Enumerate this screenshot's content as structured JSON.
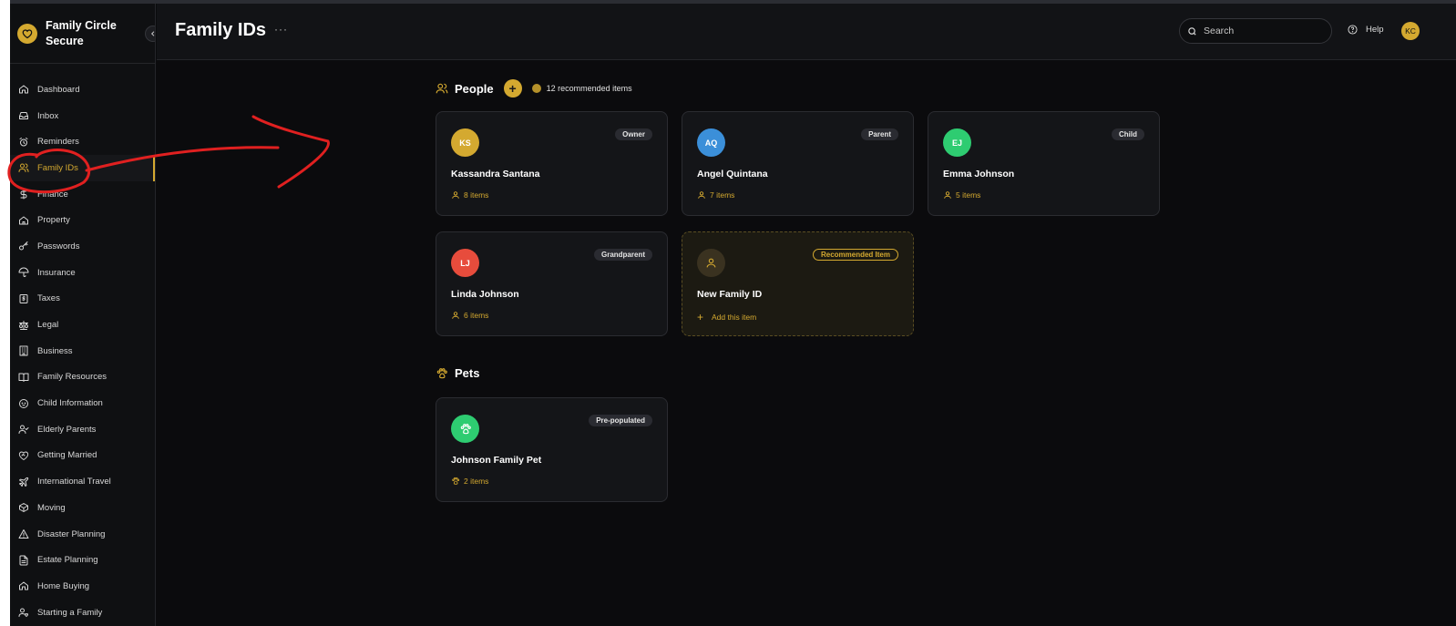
{
  "app": {
    "brand_name": "Family Circle Secure",
    "accent_color": "#d4a930"
  },
  "sidebar": {
    "items": [
      {
        "label": "Dashboard",
        "icon": "home-icon"
      },
      {
        "label": "Inbox",
        "icon": "inbox-icon"
      },
      {
        "label": "Reminders",
        "icon": "alarm-clock-icon"
      },
      {
        "label": "Family IDs",
        "icon": "users-icon",
        "active": true
      },
      {
        "label": "Finance",
        "icon": "dollar-icon"
      },
      {
        "label": "Property",
        "icon": "house-icon"
      },
      {
        "label": "Passwords",
        "icon": "key-icon"
      },
      {
        "label": "Insurance",
        "icon": "umbrella-icon"
      },
      {
        "label": "Taxes",
        "icon": "receipt-dollar-icon"
      },
      {
        "label": "Legal",
        "icon": "scale-icon"
      },
      {
        "label": "Business",
        "icon": "building-icon"
      },
      {
        "label": "Family Resources",
        "icon": "book-icon"
      },
      {
        "label": "Child Information",
        "icon": "baby-icon"
      },
      {
        "label": "Elderly Parents",
        "icon": "user-check-icon"
      },
      {
        "label": "Getting Married",
        "icon": "heart-handshake-icon"
      },
      {
        "label": "International Travel",
        "icon": "plane-icon"
      },
      {
        "label": "Moving",
        "icon": "box-icon"
      },
      {
        "label": "Disaster Planning",
        "icon": "warning-icon"
      },
      {
        "label": "Estate Planning",
        "icon": "document-icon"
      },
      {
        "label": "Home Buying",
        "icon": "home-icon"
      },
      {
        "label": "Starting a Family",
        "icon": "user-heart-icon"
      }
    ]
  },
  "header": {
    "title": "Family IDs",
    "more": "···",
    "search_placeholder": "Search",
    "help_label": "Help",
    "user_initials": "KC"
  },
  "people": {
    "title": "People",
    "add_symbol": "+",
    "recommended_text": "12 recommended items",
    "cards": [
      {
        "initials": "KS",
        "name": "Kassandra Santana",
        "role": "Owner",
        "count": "8 items",
        "color": "#d4a930"
      },
      {
        "initials": "AQ",
        "name": "Angel Quintana",
        "role": "Parent",
        "count": "7 items",
        "color": "#3b8fd9"
      },
      {
        "initials": "EJ",
        "name": "Emma Johnson",
        "role": "Child",
        "count": "5 items",
        "color": "#2ecc71"
      },
      {
        "initials": "LJ",
        "name": "Linda Johnson",
        "role": "Grandparent",
        "count": "6 items",
        "color": "#e74c3c"
      }
    ],
    "recommended_card": {
      "name": "New Family ID",
      "badge": "Recommended Item",
      "action": "Add this item"
    }
  },
  "pets": {
    "title": "Pets",
    "cards": [
      {
        "name": "Johnson Family Pet",
        "badge": "Pre-populated",
        "count": "2 items",
        "color": "#2ecc71"
      }
    ]
  }
}
